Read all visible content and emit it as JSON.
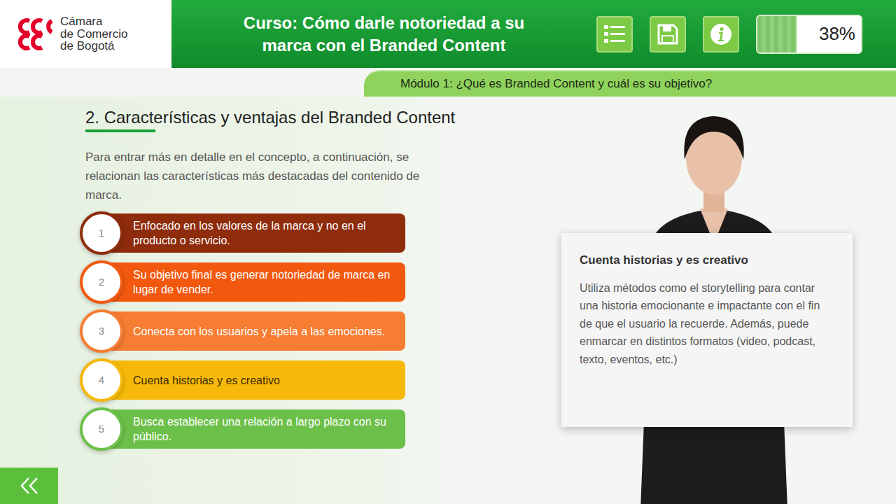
{
  "logo": {
    "lines": [
      "Cámara",
      "de Comercio",
      "de Bogotá"
    ]
  },
  "header": {
    "title": "Curso: Cómo darle notoriedad a su marca con el Branded Content"
  },
  "progress": {
    "level": 0.38,
    "reading": "38%"
  },
  "module": {
    "title": "Módulo 1: ¿Qué es Branded Content y cuál es su objetivo?"
  },
  "section": {
    "title": "2. Características y ventajas del Branded Content",
    "intro": "Para entrar más en detalle en el concepto, a continuación, se relacionan las características más destacadas del contenido de marca."
  },
  "items": [
    {
      "number": "1",
      "text": "Enfocado en los valores de la marca y no en el producto o servicio.",
      "color": "#8e2c0c"
    },
    {
      "number": "2",
      "text": "Su objetivo final es generar notoriedad de marca en lugar de vender.",
      "color": "#f2590f"
    },
    {
      "number": "3",
      "text": "Conecta con los usuarios y apela a las emociones.",
      "color": "#f77d33"
    },
    {
      "number": "4",
      "text": "Cuenta historias y es creativo",
      "color": "#f6b90a"
    },
    {
      "number": "5",
      "text": "Busca establecer una relación a largo plazo con su público.",
      "color": "#6cc04a"
    }
  ],
  "card": {
    "title": "Cuenta historias y es creativo",
    "body": "Utiliza métodos como el storytelling para contar una historia emocionante e impactante con el fin de que el usuario la recuerde. Además, puede enmarcar en distintos formatos (video, podcast, texto, eventos, etc.)"
  }
}
